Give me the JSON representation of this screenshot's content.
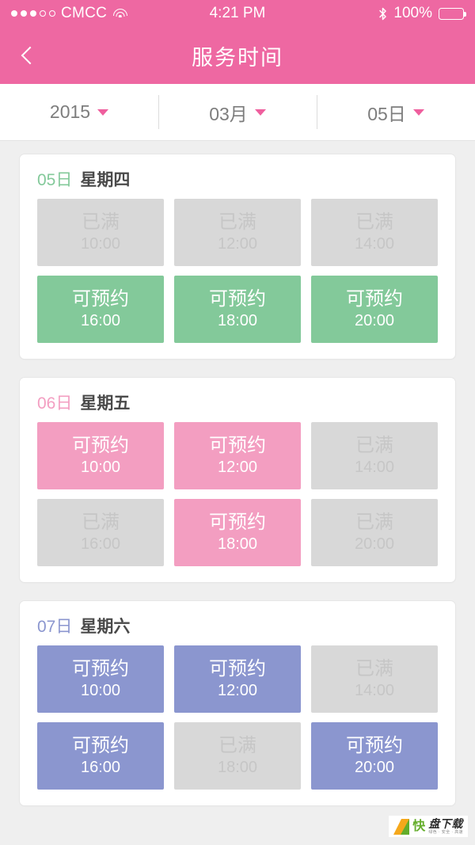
{
  "status_bar": {
    "signal_dots_filled": 3,
    "signal_dots_total": 5,
    "carrier": "CMCC",
    "wifi_icon": "wifi-icon",
    "time": "4:21 PM",
    "bluetooth_icon": "bluetooth-icon",
    "battery_percent": "100%",
    "battery_level": 100
  },
  "nav": {
    "back_icon": "chevron-left-icon",
    "title": "服务时间"
  },
  "date_picker": {
    "year": {
      "label": "2015",
      "caret_icon": "caret-down-icon"
    },
    "month": {
      "label": "03月",
      "caret_icon": "caret-down-icon"
    },
    "day": {
      "label": "05日",
      "caret_icon": "caret-down-icon"
    }
  },
  "colors": {
    "brand_pink": "#ee68a2",
    "caret_pink": "#ef5f9e",
    "available_green": "#83c99a",
    "available_pink": "#f39ec1",
    "available_blue": "#8b96cf",
    "full_gray": "#d8d8d8",
    "full_text": "#c6c6c6",
    "page_bg": "#efefef",
    "card_bg": "#ffffff"
  },
  "labels": {
    "available": "可预约",
    "full": "已满"
  },
  "cards": [
    {
      "day": "05日",
      "weekday": "星期四",
      "accent": "#83c99a",
      "day_color": "#83c99a",
      "slots": [
        {
          "status": "已满",
          "time": "10:00",
          "available": false
        },
        {
          "status": "已满",
          "time": "12:00",
          "available": false
        },
        {
          "status": "已满",
          "time": "14:00",
          "available": false
        },
        {
          "status": "可预约",
          "time": "16:00",
          "available": true
        },
        {
          "status": "可预约",
          "time": "18:00",
          "available": true
        },
        {
          "status": "可预约",
          "time": "20:00",
          "available": true
        }
      ]
    },
    {
      "day": "06日",
      "weekday": "星期五",
      "accent": "#f39ec1",
      "day_color": "#f39ec1",
      "slots": [
        {
          "status": "可预约",
          "time": "10:00",
          "available": true
        },
        {
          "status": "可预约",
          "time": "12:00",
          "available": true
        },
        {
          "status": "已满",
          "time": "14:00",
          "available": false
        },
        {
          "status": "已满",
          "time": "16:00",
          "available": false
        },
        {
          "status": "可预约",
          "time": "18:00",
          "available": true
        },
        {
          "status": "已满",
          "time": "20:00",
          "available": false
        }
      ]
    },
    {
      "day": "07日",
      "weekday": "星期六",
      "accent": "#8b96cf",
      "day_color": "#8b96cf",
      "slots": [
        {
          "status": "可预约",
          "time": "10:00",
          "available": true
        },
        {
          "status": "可预约",
          "time": "12:00",
          "available": true
        },
        {
          "status": "已满",
          "time": "14:00",
          "available": false
        },
        {
          "status": "可预约",
          "time": "16:00",
          "available": true
        },
        {
          "status": "已满",
          "time": "18:00",
          "available": false
        },
        {
          "status": "可预约",
          "time": "20:00",
          "available": true
        }
      ]
    }
  ],
  "watermark": {
    "logo_icon": "k-logo-icon",
    "brand": "快",
    "name": "盘下载",
    "tagline": "绿色 · 安全 · 高速"
  }
}
